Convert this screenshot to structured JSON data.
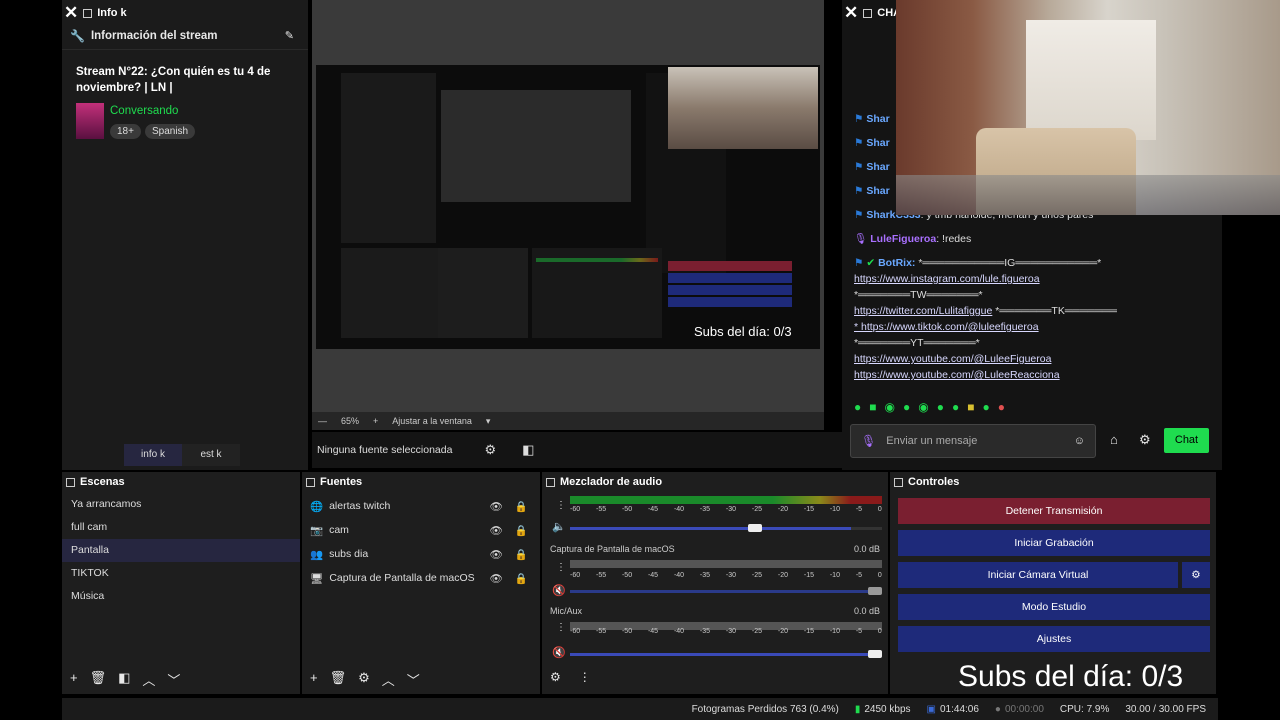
{
  "info_panel": {
    "dock_title": "Info k",
    "section_title": "Información del stream",
    "stream_title": "Stream N°22: ¿Con quién es tu 4 de noviembre? | LN |",
    "category": "Conversando",
    "tags": [
      "18+",
      "Spanish"
    ],
    "tabs": [
      "info k",
      "est k"
    ]
  },
  "preview": {
    "zoom": "65%",
    "fit_label": "Ajustar a la ventana",
    "no_source": "Ninguna fuente seleccionada",
    "subs_overlay": "Subs del día: 0/3"
  },
  "chat": {
    "dock_title": "CHA",
    "messages": [
      {
        "user": "Shar",
        "text": ""
      },
      {
        "user": "Shar",
        "text": ""
      },
      {
        "user": "Shar",
        "text": ""
      },
      {
        "user": "Shar",
        "text": ""
      },
      {
        "user": "SharkC333",
        "text": ": y tmb hanolde, merian y unos pares"
      },
      {
        "user": "LuleFigueroa",
        "text": ": !redes"
      }
    ],
    "bot": {
      "user": "BotRix:",
      "lines": [
        "*═══════════IG═══════════*",
        "https://www.instagram.com/lule.figueroa",
        "*═══════TW═══════*",
        "https://twitter.com/Lulitafiggue",
        "*═══════TK═══════",
        "* https://www.tiktok.com/@luleefigueroa",
        "*═══════YT═══════*",
        "https://www.youtube.com/@LuleeFigueroa",
        "https://www.youtube.com/@LuleeReacciona"
      ]
    },
    "input_placeholder": "Enviar un mensaje",
    "send_label": "Chat"
  },
  "scenes": {
    "title": "Escenas",
    "items": [
      "Ya arrancamos",
      "full cam",
      "Pantalla",
      "TIKTOK",
      "Música"
    ],
    "selected": "Pantalla"
  },
  "sources": {
    "title": "Fuentes",
    "items": [
      {
        "icon": "globe-icon",
        "label": "alertas twitch"
      },
      {
        "icon": "camera-icon",
        "label": "cam"
      },
      {
        "icon": "people-icon",
        "label": "subs dia"
      },
      {
        "icon": "monitor-icon",
        "label": "Captura de Pantalla de macOS"
      }
    ]
  },
  "mixer": {
    "title": "Mezclador de audio",
    "ticks": [
      "-60",
      "-55",
      "-50",
      "-45",
      "-40",
      "-35",
      "-30",
      "-25",
      "-20",
      "-15",
      "-10",
      "-5",
      "0"
    ],
    "channels": [
      {
        "name": "",
        "db": "",
        "volume": 0.9
      },
      {
        "name": "Captura de Pantalla de macOS",
        "db": "0.0 dB",
        "volume": 1.0
      },
      {
        "name": "Mic/Aux",
        "db": "0.0 dB",
        "volume": 1.0
      }
    ]
  },
  "controls": {
    "title": "Controles",
    "buttons": [
      "Detener Transmisión",
      "Iniciar Grabación",
      "Iniciar Cámara Virtual",
      "Modo Estudio",
      "Ajustes"
    ],
    "subs_overlay": "Subs del día: 0/3"
  },
  "status": {
    "dropped": "Fotogramas Perdidos 763 (0.4%)",
    "bitrate": "2450 kbps",
    "stream_time": "01:44:06",
    "rec_time": "00:00:00",
    "cpu": "CPU: 7.9%",
    "fps": "30.00 / 30.00 FPS"
  },
  "colors": {
    "accent_green": "#1fdc4f",
    "control_blue": "#1e2a7a",
    "control_red": "#7a1f30",
    "bot_purple": "#a970ff"
  }
}
